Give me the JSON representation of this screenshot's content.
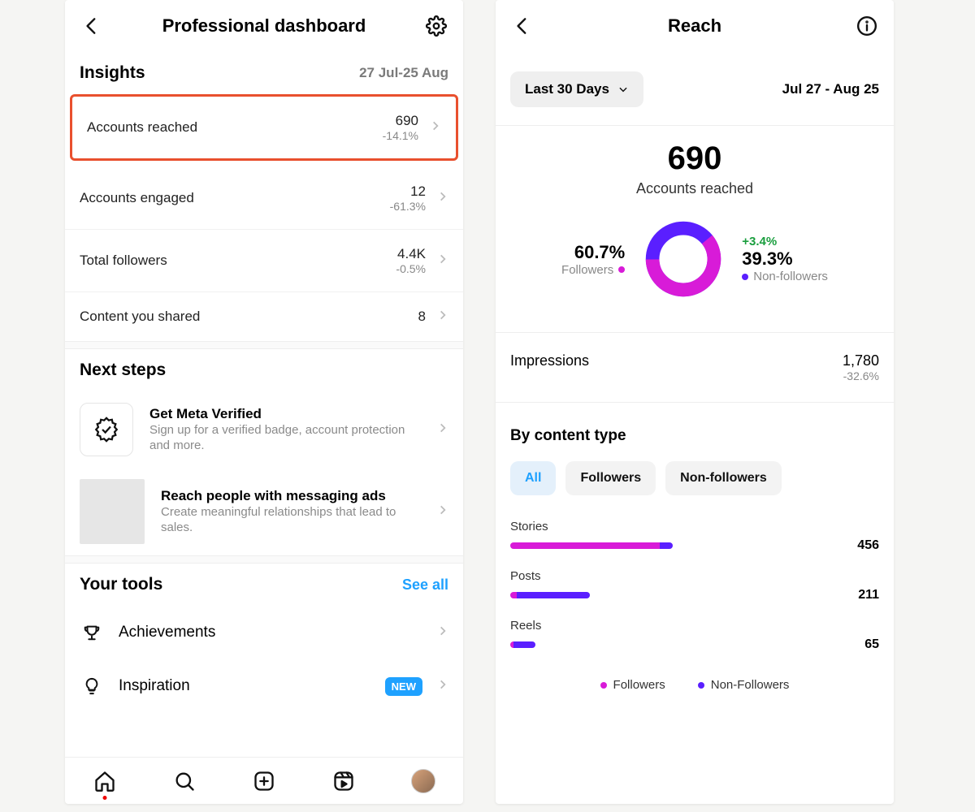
{
  "colors": {
    "followers": "#d81bd8",
    "nonfollowers": "#5a1fff",
    "highlight": "#e9502e",
    "blue": "#1ea1ff"
  },
  "left": {
    "title": "Professional dashboard",
    "insights_heading": "Insights",
    "date_range": "27 Jul-25 Aug",
    "rows": [
      {
        "label": "Accounts reached",
        "value": "690",
        "delta": "-14.1%",
        "highlight": true
      },
      {
        "label": "Accounts engaged",
        "value": "12",
        "delta": "-61.3%"
      },
      {
        "label": "Total followers",
        "value": "4.4K",
        "delta": "-0.5%"
      },
      {
        "label": "Content you shared",
        "value": "8"
      }
    ],
    "next_steps_heading": "Next steps",
    "next_steps": [
      {
        "title": "Get Meta Verified",
        "subtitle": "Sign up for a verified badge, account protection and more."
      },
      {
        "title": "Reach people with messaging ads",
        "subtitle": "Create meaningful relationships that lead to sales."
      }
    ],
    "tools_heading": "Your tools",
    "see_all": "See all",
    "tools": [
      {
        "label": "Achievements"
      },
      {
        "label": "Inspiration",
        "badge": "NEW"
      }
    ]
  },
  "right": {
    "title": "Reach",
    "range_pill": "Last 30 Days",
    "date_text": "Jul 27 - Aug 25",
    "reach_value": "690",
    "reach_caption": "Accounts reached",
    "followers": {
      "pct": "60.7%",
      "label": "Followers"
    },
    "nonfollowers": {
      "pct": "39.3%",
      "label": "Non-followers",
      "delta": "+3.4%"
    },
    "impressions": {
      "label": "Impressions",
      "value": "1,780",
      "delta": "-32.6%"
    },
    "content_type_heading": "By content type",
    "tabs": [
      "All",
      "Followers",
      "Non-followers"
    ],
    "bars": [
      {
        "label": "Stories",
        "value": "456",
        "followers": 47,
        "nonfollowers": 4
      },
      {
        "label": "Posts",
        "value": "211",
        "followers": 2,
        "nonfollowers": 23
      },
      {
        "label": "Reels",
        "value": "65",
        "followers": 1,
        "nonfollowers": 7
      }
    ],
    "legend": {
      "followers": "Followers",
      "nonfollowers": "Non-Followers"
    }
  },
  "chart_data": [
    {
      "type": "pie",
      "title": "Accounts reached breakdown",
      "series": [
        {
          "name": "Followers",
          "values": [
            60.7
          ]
        },
        {
          "name": "Non-followers",
          "values": [
            39.3
          ]
        }
      ]
    },
    {
      "type": "bar",
      "title": "By content type",
      "categories": [
        "Stories",
        "Posts",
        "Reels"
      ],
      "series": [
        {
          "name": "Followers",
          "values": [
            430,
            20,
            8
          ]
        },
        {
          "name": "Non-followers",
          "values": [
            26,
            191,
            57
          ]
        }
      ],
      "totals": [
        456,
        211,
        65
      ]
    }
  ]
}
